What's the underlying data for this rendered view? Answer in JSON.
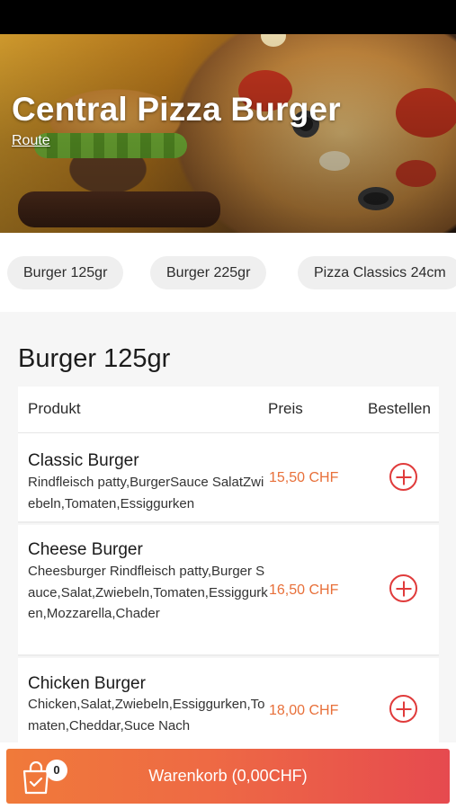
{
  "restaurant": {
    "name": "Central Pizza Burger",
    "route_label": "Route"
  },
  "categories": [
    {
      "label": "Burger 125gr"
    },
    {
      "label": "Burger 225gr"
    },
    {
      "label": "Pizza Classics 24cm"
    }
  ],
  "section": {
    "title": "Burger 125gr",
    "columns": {
      "product": "Produkt",
      "price": "Preis",
      "order": "Bestellen"
    },
    "products": [
      {
        "name": "Classic Burger",
        "description": "Rindfleisch patty,BurgerSauce SalatZwiebeln,Tomaten,Essiggurken",
        "price": "15,50 CHF"
      },
      {
        "name": "Cheese Burger",
        "description": "Cheesburger Rindfleisch patty,Burger Sauce,Salat,Zwiebeln,Tomaten,Essiggurken,Mozzarella,Chader",
        "price": "16,50 CHF"
      },
      {
        "name": "Chicken Burger",
        "description": "Chicken,Salat,Zwiebeln,Essiggurken,Tomaten,Cheddar,Suce Nach",
        "price": "18,00 CHF"
      }
    ]
  },
  "cart": {
    "count": "0",
    "label": "Warenkorb (0,00CHF)"
  },
  "colors": {
    "accent_price": "#e8703a",
    "add_button": "#e03b3b",
    "cart_gradient_start": "#f07a3a",
    "cart_gradient_end": "#e64a4f"
  },
  "icons": {
    "add": "plus-circle-icon",
    "cart": "shopping-bag-icon"
  }
}
